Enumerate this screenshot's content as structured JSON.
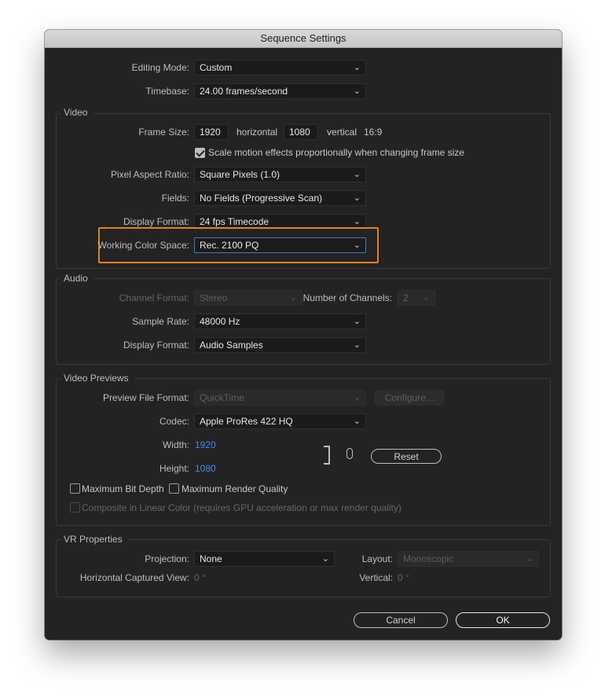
{
  "window": {
    "title": "Sequence Settings"
  },
  "top": {
    "editing_mode_label": "Editing Mode:",
    "editing_mode_value": "Custom",
    "timebase_label": "Timebase:",
    "timebase_value": "24.00  frames/second"
  },
  "video": {
    "title": "Video",
    "frame_size_label": "Frame Size:",
    "frame_width": "1920",
    "horizontal": "horizontal",
    "frame_height": "1080",
    "vertical": "vertical",
    "aspect": "16:9",
    "scale_checkbox_label": "Scale motion effects proportionally when changing frame size",
    "scale_checked": true,
    "pixel_aspect_label": "Pixel Aspect Ratio:",
    "pixel_aspect_value": "Square Pixels (1.0)",
    "fields_label": "Fields:",
    "fields_value": "No Fields (Progressive Scan)",
    "display_format_label": "Display Format:",
    "display_format_value": "24 fps Timecode",
    "working_color_label": "Working Color Space:",
    "working_color_value": "Rec. 2100 PQ"
  },
  "audio": {
    "title": "Audio",
    "channel_format_label": "Channel Format:",
    "channel_format_value": "Stereo",
    "num_channels_label": "Number of Channels:",
    "num_channels_value": "2",
    "sample_rate_label": "Sample Rate:",
    "sample_rate_value": "48000 Hz",
    "display_format_label": "Display Format:",
    "display_format_value": "Audio Samples"
  },
  "previews": {
    "title": "Video Previews",
    "preview_format_label": "Preview File Format:",
    "preview_format_value": "QuickTime",
    "configure_label": "Configure...",
    "codec_label": "Codec:",
    "codec_value": "Apple ProRes 422 HQ",
    "width_label": "Width:",
    "width_value": "1920",
    "height_label": "Height:",
    "height_value": "1080",
    "reset_label": "Reset",
    "max_bit_depth_label": "Maximum Bit Depth",
    "max_render_quality_label": "Maximum Render Quality",
    "composite_label": "Composite in Linear Color (requires GPU acceleration or max render quality)"
  },
  "vr": {
    "title": "VR Properties",
    "projection_label": "Projection:",
    "projection_value": "None",
    "layout_label": "Layout:",
    "layout_value": "Monoscopic",
    "hview_label": "Horizontal Captured View:",
    "hview_value": "0 °",
    "vertical_label": "Vertical:",
    "vertical_value": "0 °"
  },
  "footer": {
    "cancel_label": "Cancel",
    "ok_label": "OK"
  },
  "icons": {
    "chevron": "chevron-down-icon",
    "link": "link-icon"
  },
  "colors": {
    "accent_highlight": "#e0821f",
    "blue_value": "#3e8ee0",
    "panel_bg": "#232323"
  }
}
